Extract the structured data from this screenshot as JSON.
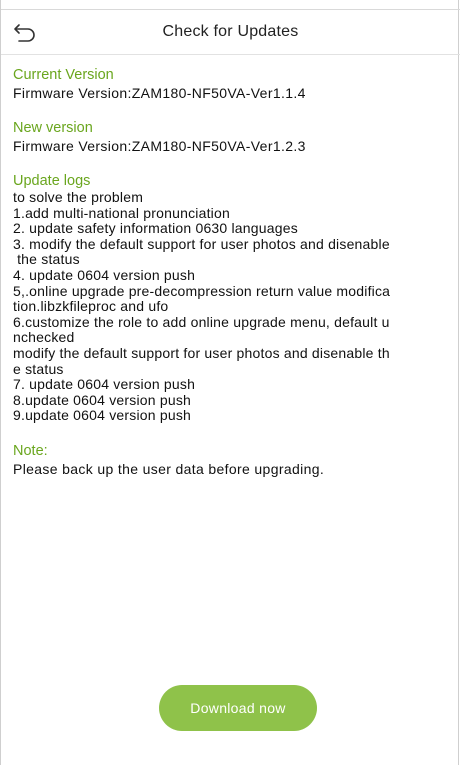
{
  "header": {
    "title": "Check for Updates",
    "back_icon": "back-arrow-icon"
  },
  "current": {
    "heading": "Current Version",
    "firmware": "Firmware Version:ZAM180-NF50VA-Ver1.1.4"
  },
  "new": {
    "heading": "New version",
    "firmware": "Firmware Version:ZAM180-NF50VA-Ver1.2.3"
  },
  "logs": {
    "heading": "Update logs",
    "lines": [
      "to solve the problem",
      "1.add multi-national pronunciation",
      "2. update safety information 0630 languages",
      "3. modify the default support for user photos and disenable",
      " the status",
      "4. update 0604 version push",
      "5,.online upgrade pre-decompression return value modifica",
      "tion.libzkfileproc and ufo",
      "6.customize the role to add online upgrade menu, default u",
      "nchecked",
      "modify the default support for user photos and disenable th",
      "e status",
      "7. update 0604 version push",
      "8.update 0604 version push",
      "9.update 0604 version push"
    ]
  },
  "note": {
    "heading": "Note:",
    "text": "Please back up the user data before upgrading."
  },
  "actions": {
    "download_label": "Download now"
  },
  "colors": {
    "accent_text": "#6aa61e",
    "button_bg": "#8fc24a"
  }
}
